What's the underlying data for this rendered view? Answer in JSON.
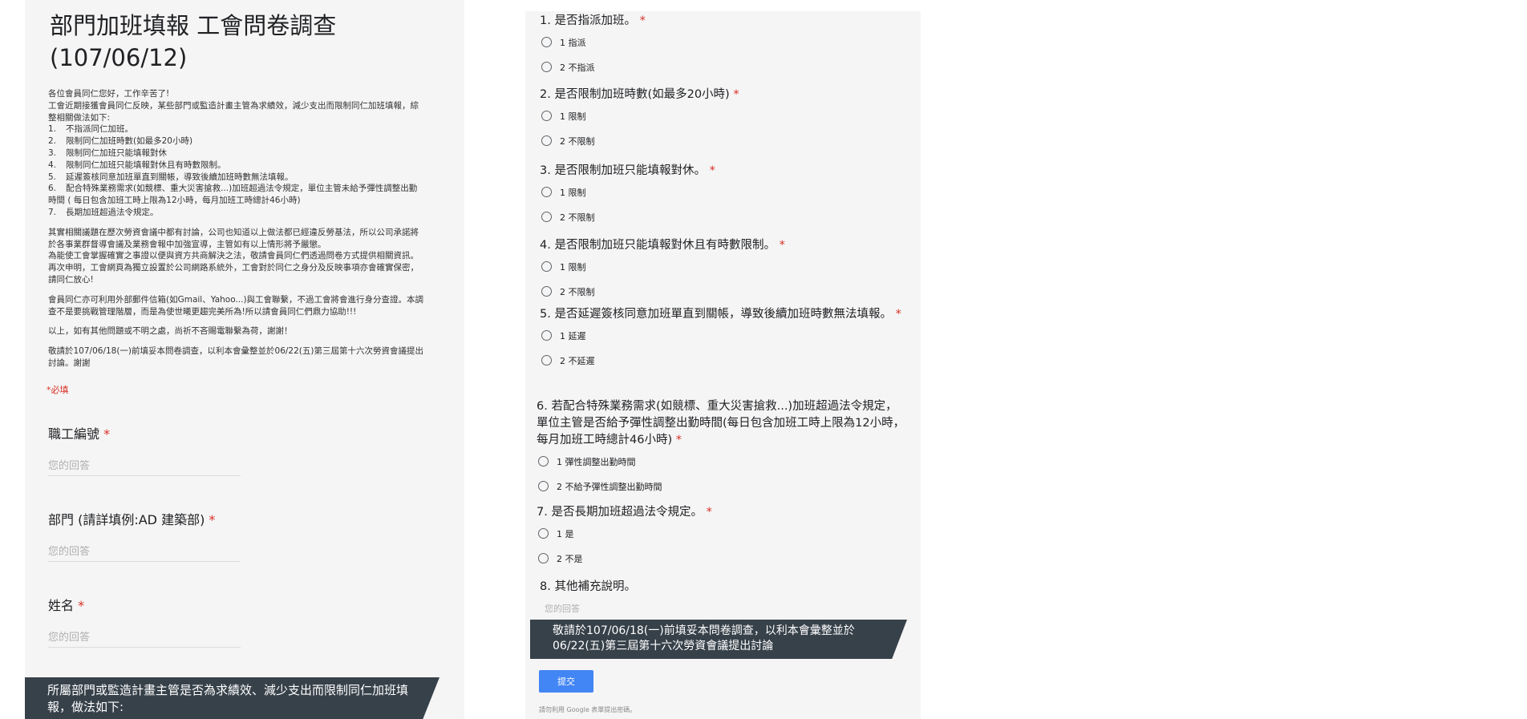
{
  "left": {
    "title": "部門加班填報 工會問卷調查 (107/06/12)",
    "intro": {
      "greeting": "各位會員同仁您好，工作辛苦了!",
      "lines": [
        "工會近期接獲會員同仁反映，某些部門或監造計畫主管為求績效，減少支出而限制同仁加班填報，綜",
        "整相關做法如下:"
      ],
      "items": [
        "不指派同仁加班。",
        "限制同仁加班時數(如最多20小時)",
        "限制同仁加班只能填報對休",
        "限制同仁加班只能填報對休且有時數限制。",
        "延遲簽核同意加班單直到關帳，導致後續加班時數無法填報。",
        "配合特殊業務需求(如競標、重大災害搶救...)加班超過法令規定，單位主管未給予彈性調整出勤",
        "長期加班超過法令規定。"
      ],
      "item6_cont": "時間 ( 每日包含加班工時上限為12小時，每月加班工時總計46小時)"
    },
    "para2": [
      "其實相關議題在歷次勞資會議中都有討論，公司也知道以上做法都已經違反勞基法，所以公司承諾將",
      "於各事業群督導會議及業務會報中加強宣導，主管如有以上情形將予嚴懲。",
      "為能使工會掌握確實之事證以便與資方共商解決之法，敬請會員同仁們透過問卷方式提供相關資訊。",
      "再次申明，工會網頁為獨立設置於公司網路系統外，工會對於同仁之身分及反映事項亦會確實保密，",
      "請同仁放心!"
    ],
    "para3": [
      "會員同仁亦可利用外部郵件信箱(如Gmail、Yahoo...)與工會聯繫，不過工會將會進行身分查證。本調",
      "查不是要挑戰管理階層，而是為使世曦更趨完美所為!所以請會員同仁們鼎力協助!!!"
    ],
    "para4": "以上，如有其他問題或不明之處，尚祈不吝賜電聯繫為荷，謝謝！",
    "para5": [
      "敬請於107/06/18(一)前填妥本問卷調查，以利本會彙整並於06/22(五)第三屆第十六次勞資會議提出",
      "討論。謝謝"
    ],
    "required_note": "*必填",
    "fields": [
      {
        "label": "職工編號",
        "placeholder": "您的回答"
      },
      {
        "label": "部門 (請詳填例:AD 建築部)",
        "placeholder": "您的回答"
      },
      {
        "label": "姓名",
        "placeholder": "您的回答"
      }
    ],
    "banner": "所屬部門或監造計畫主管是否為求績效、減少支出而限制同仁加班填報，做法如下:"
  },
  "right": {
    "questions": [
      {
        "title": "1. 是否指派加班。",
        "required": true,
        "options": [
          "1 指派",
          "2 不指派"
        ]
      },
      {
        "title": "2. 是否限制加班時數(如最多20小時)",
        "required": true,
        "options": [
          "1 限制",
          "2 不限制"
        ]
      },
      {
        "title": "3. 是否限制加班只能填報對休。",
        "required": true,
        "options": [
          "1 限制",
          "2 不限制"
        ]
      },
      {
        "title": "4. 是否限制加班只能填報對休且有時數限制。",
        "required": true,
        "options": [
          "1 限制",
          "2 不限制"
        ]
      },
      {
        "title": "5. 是否延遲簽核同意加班單直到關帳，導致後續加班時數無法填報。",
        "required": true,
        "options": [
          "1 延遲",
          "2 不延遲"
        ]
      },
      {
        "title": "6. 若配合特殊業務需求(如競標、重大災害搶救...)加班超過法令規定，單位主管是否給予彈性調整出勤時間(每日包含加班工時上限為12小時，每月加班工時總計46小時)",
        "required": true,
        "options": [
          "1 彈性調整出勤時間",
          "2 不給予彈性調整出勤時間"
        ]
      },
      {
        "title": "7. 是否長期加班超過法令規定。",
        "required": true,
        "options": [
          "1 是",
          "2 不是"
        ]
      },
      {
        "title": "8. 其他補充說明。",
        "required": false,
        "options": []
      }
    ],
    "answer_placeholder": "您的回答",
    "banner": "敬請於107/06/18(一)前填妥本問卷調查，以利本會彙整並於06/22(五)第三屆第十六次勞資會議提出討論",
    "submit_label": "提交",
    "footer": "請勿利用 Google 表單提出密碼。",
    "star": "*"
  }
}
